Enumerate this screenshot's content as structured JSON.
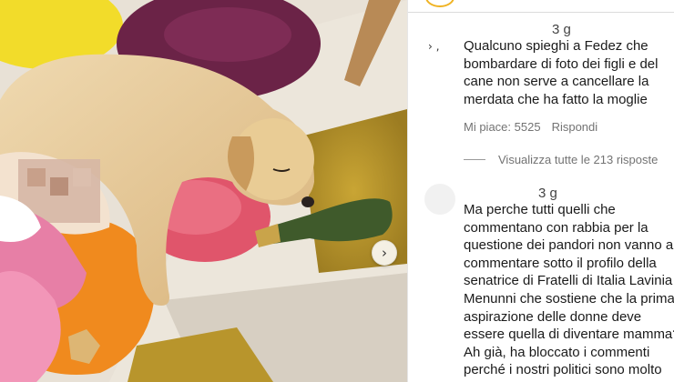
{
  "post": {
    "next_icon": "chevron-right-icon"
  },
  "comments": [
    {
      "time": "3 g",
      "text": "Qualcuno spieghi a Fedez che bombardare di foto dei figli e del cane non serve a cancellare la merdata che ha fatto la moglie",
      "likes": "Mi piace: 5525",
      "reply_label": "Rispondi",
      "view_replies": "Visualizza tutte le 213 risposte"
    },
    {
      "time": "3 g",
      "text": "Ma perche tutti quelli che commentano con rabbia per la questione dei pandori non vanno a commentare sotto il profilo della senatrice di Fratelli di Italia Lavinia Menunni che sostiene che la prima aspirazione delle donne deve essere quella di diventare mamma? Ah già, ha bloccato i commenti perché i nostri politici sono molto"
    }
  ],
  "colors": {
    "meta_text": "#737373",
    "story_ring": "#f0b323"
  }
}
